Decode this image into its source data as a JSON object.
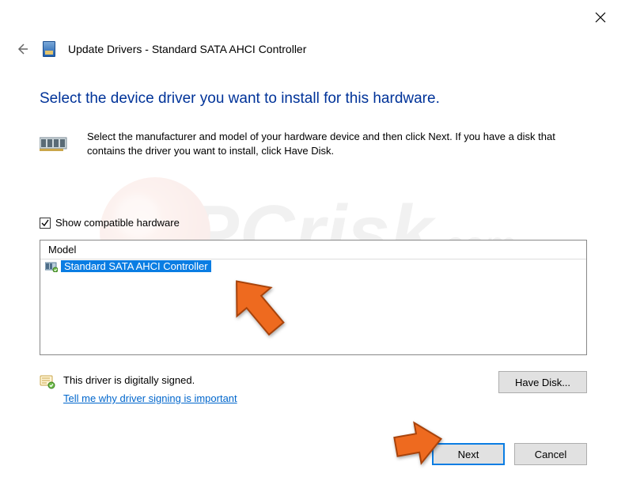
{
  "window": {
    "title_prefix": "Update Drivers - ",
    "device_name": "Standard SATA AHCI Controller"
  },
  "heading": "Select the device driver you want to install for this hardware.",
  "instruction": "Select the manufacturer and model of your hardware device and then click Next. If you have a disk that contains the driver you want to install, click Have Disk.",
  "checkbox": {
    "label": "Show compatible hardware",
    "checked": true
  },
  "list": {
    "column": "Model",
    "items": [
      {
        "label": "Standard SATA AHCI Controller",
        "selected": true
      }
    ]
  },
  "signature": {
    "text": "This driver is digitally signed.",
    "link": "Tell me why driver signing is important"
  },
  "buttons": {
    "have_disk": "Have Disk...",
    "next": "Next",
    "cancel": "Cancel"
  },
  "watermark": {
    "brand_main": "PCrisk",
    "brand_suffix": ".com"
  }
}
